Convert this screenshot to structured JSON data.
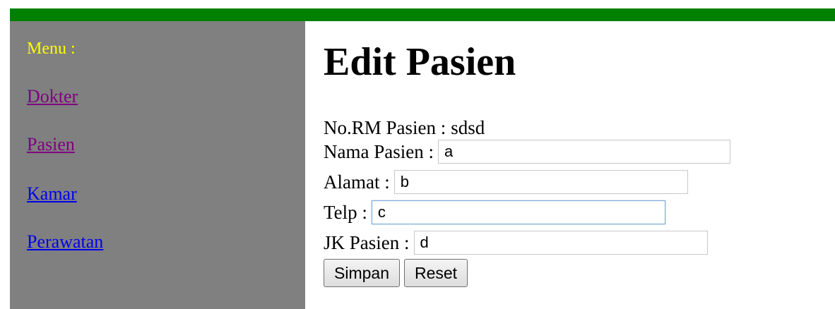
{
  "colors": {
    "top_bar": "#008000",
    "sidebar_bg": "#808080",
    "menu_title": "#ffff00",
    "link_visited": "#800080",
    "link_unvisited": "#0000ee"
  },
  "sidebar": {
    "menu_title": "Menu :",
    "items": [
      {
        "label": "Dokter",
        "state": "visited"
      },
      {
        "label": "Pasien",
        "state": "visited"
      },
      {
        "label": "Kamar",
        "state": "unvisited"
      },
      {
        "label": "Perawatan",
        "state": "unvisited"
      }
    ]
  },
  "form": {
    "title": "Edit Pasien",
    "rm_label": "No.RM Pasien :",
    "rm_value": "sdsd",
    "fields": [
      {
        "label": "Nama Pasien :",
        "value": "a"
      },
      {
        "label": "Alamat :",
        "value": "b"
      },
      {
        "label": "Telp :",
        "value": "c"
      },
      {
        "label": "JK Pasien :",
        "value": "d"
      }
    ],
    "buttons": {
      "save": "Simpan",
      "reset": "Reset"
    }
  }
}
